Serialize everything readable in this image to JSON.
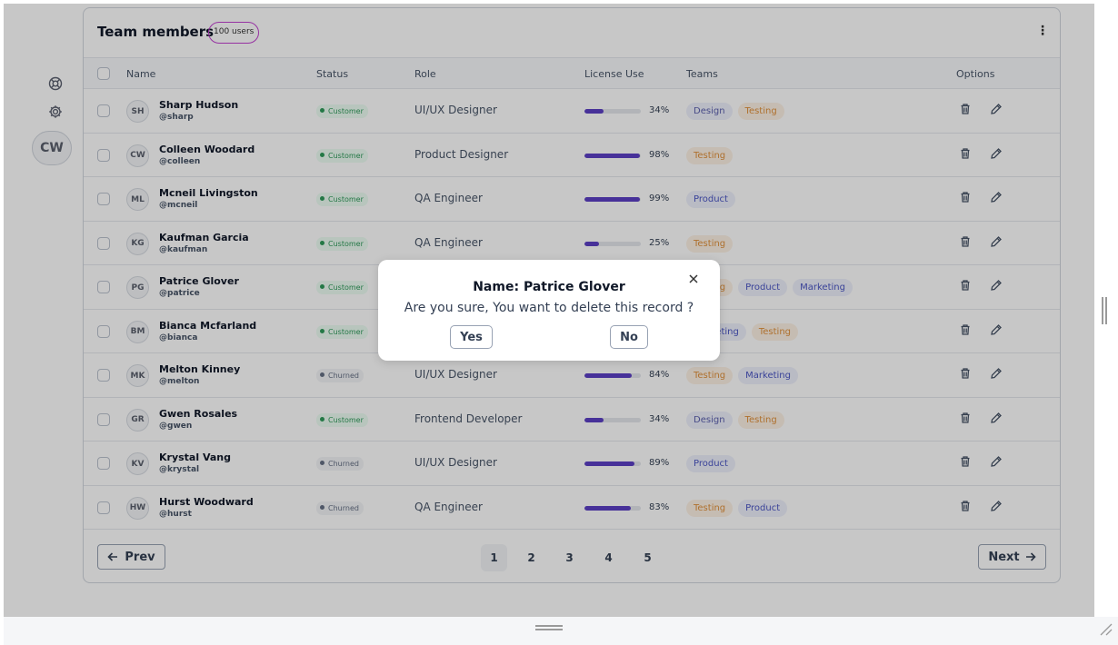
{
  "header": {
    "title": "Team members",
    "users_badge": "100 users"
  },
  "sidebar": {
    "icons": [
      "life-ring-icon",
      "gear-icon"
    ],
    "avatar_initials": "CW"
  },
  "table": {
    "columns": [
      "Name",
      "Status",
      "Role",
      "License Use",
      "Teams",
      "Options"
    ],
    "rows": [
      {
        "initials": "SH",
        "name": "Sharp Hudson",
        "handle": "@sharp",
        "status": "Customer",
        "role": "UI/UX Designer",
        "license_pct": 34,
        "license_label": "34%",
        "teams": [
          "Design",
          "Testing"
        ]
      },
      {
        "initials": "CW",
        "name": "Colleen Woodard",
        "handle": "@colleen",
        "status": "Customer",
        "role": "Product Designer",
        "license_pct": 98,
        "license_label": "98%",
        "teams": [
          "Testing"
        ]
      },
      {
        "initials": "ML",
        "name": "Mcneil Livingston",
        "handle": "@mcneil",
        "status": "Customer",
        "role": "QA Engineer",
        "license_pct": 99,
        "license_label": "99%",
        "teams": [
          "Product"
        ]
      },
      {
        "initials": "KG",
        "name": "Kaufman Garcia",
        "handle": "@kaufman",
        "status": "Customer",
        "role": "QA Engineer",
        "license_pct": 25,
        "license_label": "25%",
        "teams": [
          "Testing"
        ]
      },
      {
        "initials": "PG",
        "name": "Patrice Glover",
        "handle": "@patrice",
        "status": "Customer",
        "role": "",
        "license_pct": null,
        "license_label": "",
        "teams": [
          "Testing",
          "Product",
          "Marketing"
        ]
      },
      {
        "initials": "BM",
        "name": "Bianca Mcfarland",
        "handle": "@bianca",
        "status": "Customer",
        "role": "",
        "license_pct": null,
        "license_label": "",
        "teams": [
          "Marketing",
          "Testing"
        ]
      },
      {
        "initials": "MK",
        "name": "Melton Kinney",
        "handle": "@melton",
        "status": "Churned",
        "role": "UI/UX Designer",
        "license_pct": 84,
        "license_label": "84%",
        "teams": [
          "Testing",
          "Marketing"
        ]
      },
      {
        "initials": "GR",
        "name": "Gwen Rosales",
        "handle": "@gwen",
        "status": "Customer",
        "role": "Frontend Developer",
        "license_pct": 34,
        "license_label": "34%",
        "teams": [
          "Design",
          "Testing"
        ]
      },
      {
        "initials": "KV",
        "name": "Krystal Vang",
        "handle": "@krystal",
        "status": "Churned",
        "role": "UI/UX Designer",
        "license_pct": 89,
        "license_label": "89%",
        "teams": [
          "Product"
        ]
      },
      {
        "initials": "HW",
        "name": "Hurst Woodward",
        "handle": "@hurst",
        "status": "Churned",
        "role": "QA Engineer",
        "license_pct": 83,
        "license_label": "83%",
        "teams": [
          "Testing",
          "Product"
        ]
      }
    ],
    "row_option_icons": [
      "trash-icon",
      "pencil-icon"
    ]
  },
  "pagination": {
    "prev_label": "Prev",
    "next_label": "Next",
    "pages": [
      "1",
      "2",
      "3",
      "4",
      "5"
    ],
    "current_page": "1"
  },
  "modal": {
    "title": "Name: Patrice Glover",
    "message": "Are you sure, You want to delete this record ?",
    "yes_label": "Yes",
    "no_label": "No"
  },
  "colors": {
    "accent": "#5b3fc4",
    "badge_border": "#c13fd0",
    "customer_green": "#2f9a5a",
    "testing_orange": "#e0913c",
    "product_blue": "#4a55c4"
  }
}
